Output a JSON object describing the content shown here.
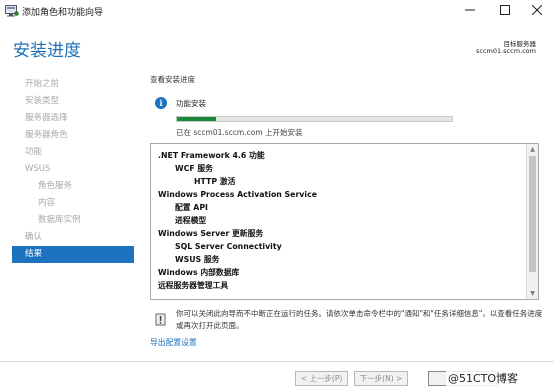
{
  "window": {
    "title": "添加角色和功能向导",
    "controls": [
      "minimize-icon",
      "maximize-icon",
      "close-icon"
    ]
  },
  "header": {
    "title": "安装进度",
    "server_label": "目标服务器",
    "server_name": "sccm01.sccm.com"
  },
  "sidebar": {
    "items": [
      {
        "label": "开始之前",
        "state": "disabled",
        "level": 0
      },
      {
        "label": "安装类型",
        "state": "disabled",
        "level": 0
      },
      {
        "label": "服务器选择",
        "state": "disabled",
        "level": 0
      },
      {
        "label": "服务器角色",
        "state": "disabled",
        "level": 0
      },
      {
        "label": "功能",
        "state": "disabled",
        "level": 0
      },
      {
        "label": "WSUS",
        "state": "disabled",
        "level": 0
      },
      {
        "label": "角色服务",
        "state": "disabled",
        "level": 1
      },
      {
        "label": "内容",
        "state": "disabled",
        "level": 1
      },
      {
        "label": "数据库实例",
        "state": "disabled",
        "level": 1
      },
      {
        "label": "确认",
        "state": "disabled",
        "level": 0
      },
      {
        "label": "结果",
        "state": "active",
        "level": 0
      }
    ]
  },
  "main": {
    "section_title": "查看安装进度",
    "progress": {
      "label": "功能安装",
      "fraction": 0.14,
      "status": "已在 sccm01.sccm.com 上开始安装"
    },
    "features": [
      {
        "text": ".NET Framework 4.6 功能",
        "level": 1
      },
      {
        "text": "WCF 服务",
        "level": 2
      },
      {
        "text": "HTTP 激活",
        "level": 3
      },
      {
        "text": "Windows Process Activation Service",
        "level": 1
      },
      {
        "text": "配置 API",
        "level": 2
      },
      {
        "text": "进程模型",
        "level": 2
      },
      {
        "text": "Windows Server 更新服务",
        "level": 1
      },
      {
        "text": "SQL Server Connectivity",
        "level": 2
      },
      {
        "text": "WSUS 服务",
        "level": 2
      },
      {
        "text": "Windows 内部数据库",
        "level": 1
      },
      {
        "text": "远程服务器管理工具",
        "level": 1
      }
    ],
    "note": "你可以关闭此向导而不中断正在运行的任务。请依次单击命令栏中的\"通知\"和\"任务详细信息\"，以查看任务进度或再次打开此页面。",
    "export_link": "导出配置设置"
  },
  "footer": {
    "prev_label": "< 上一步(P)",
    "next_label": "下一步(N) >",
    "close_label": "",
    "watermark": "@51CTO博客"
  },
  "colors": {
    "accent": "#1e73c0",
    "title_blue": "#1e6fb8",
    "progress_green": "#1a8a3a"
  }
}
